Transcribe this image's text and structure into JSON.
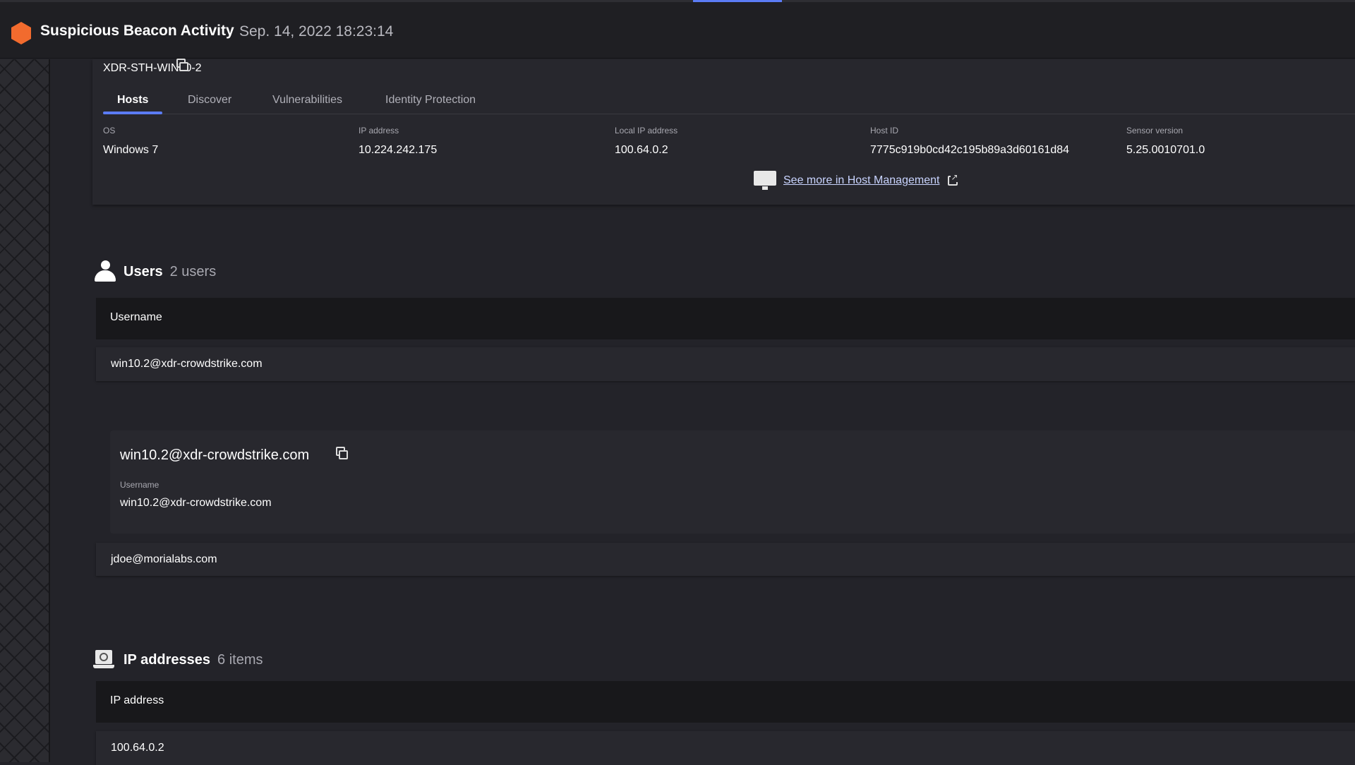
{
  "header": {
    "title": "Suspicious Beacon Activity",
    "timestamp": "Sep. 14, 2022 18:23:14"
  },
  "host": {
    "name": "XDR-STH-WIN10-2",
    "tabs": [
      {
        "label": "Hosts"
      },
      {
        "label": "Discover"
      },
      {
        "label": "Vulnerabilities"
      },
      {
        "label": "Identity Protection"
      }
    ],
    "fields": [
      {
        "label": "OS",
        "value": "Windows 7"
      },
      {
        "label": "IP address",
        "value": "10.224.242.175"
      },
      {
        "label": "Local IP address",
        "value": "100.64.0.2"
      },
      {
        "label": "Host ID",
        "value": "7775c919b0cd42c195b89a3d60161d84"
      },
      {
        "label": "Sensor version",
        "value": "5.25.0010701.0"
      }
    ],
    "see_more": "See more in Host Management"
  },
  "users": {
    "title": "Users",
    "count": "2 users",
    "column": "Username",
    "rows": [
      "win10.2@xdr-crowdstrike.com",
      "jdoe@morialabs.com"
    ],
    "expanded": {
      "title": "win10.2@xdr-crowdstrike.com",
      "label": "Username",
      "value": "win10.2@xdr-crowdstrike.com"
    }
  },
  "ips": {
    "title": "IP addresses",
    "count": "6 items",
    "column": "IP address",
    "rows": [
      "100.64.0.2"
    ]
  }
}
